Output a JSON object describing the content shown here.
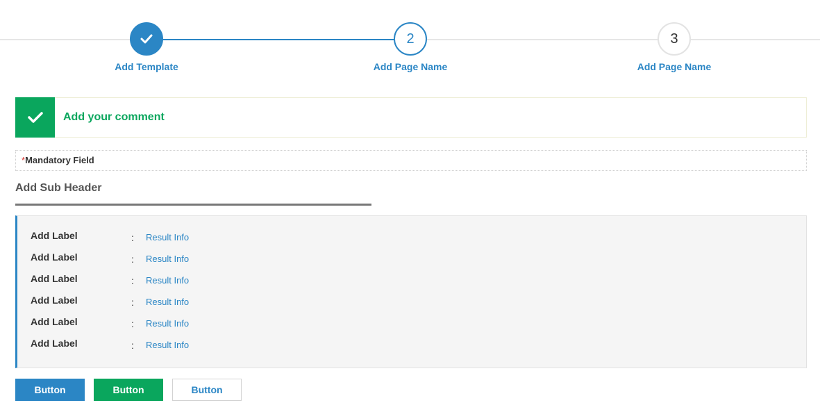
{
  "stepper": {
    "steps": [
      {
        "number": "",
        "label": "Add Template",
        "state": "done"
      },
      {
        "number": "2",
        "label": "Add Page Name",
        "state": "active"
      },
      {
        "number": "3",
        "label": "Add Page Name",
        "state": "todo"
      }
    ]
  },
  "banner": {
    "icon": "check-icon",
    "text": "Add your comment"
  },
  "mandatory": {
    "star": "*",
    "text": "Mandatory Field"
  },
  "subheader": {
    "title": "Add Sub Header"
  },
  "info": {
    "rows": [
      {
        "label": "Add Label",
        "colon": ":",
        "value": "Result Info"
      },
      {
        "label": "Add Label",
        "colon": ":",
        "value": "Result Info"
      },
      {
        "label": "Add Label",
        "colon": ":",
        "value": "Result Info"
      },
      {
        "label": "Add Label",
        "colon": ":",
        "value": "Result Info"
      },
      {
        "label": "Add Label",
        "colon": ":",
        "value": "Result Info"
      },
      {
        "label": "Add Label",
        "colon": ":",
        "value": "Result Info"
      }
    ]
  },
  "buttons": {
    "primary": "Button",
    "success": "Button",
    "outline": "Button"
  },
  "colors": {
    "primary": "#2b86c5",
    "success": "#0aa65d",
    "required": "#d9312b"
  }
}
